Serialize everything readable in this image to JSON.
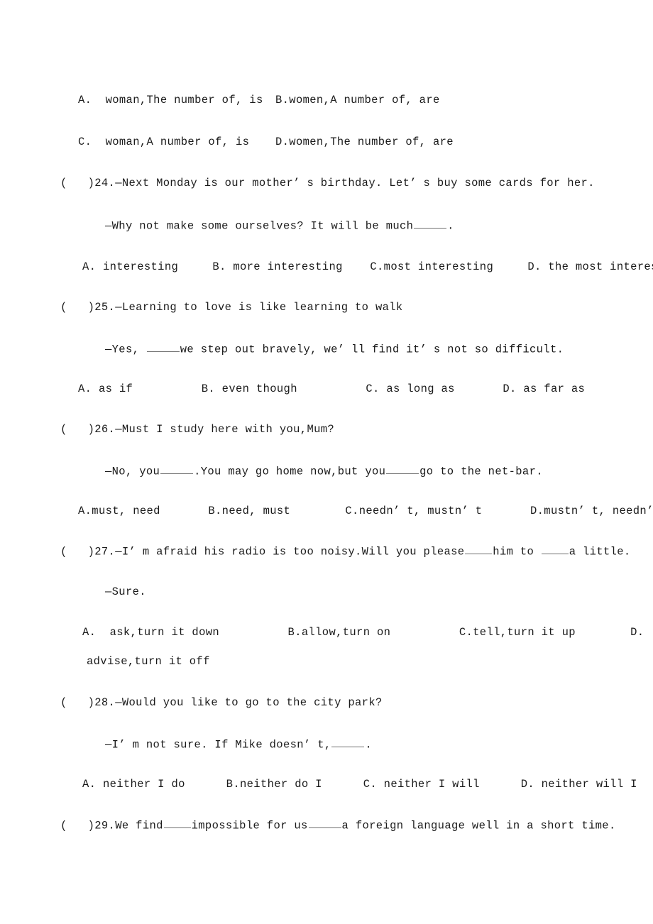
{
  "document": {
    "type": "exam-paper",
    "language": "en",
    "page_background": "#ffffff",
    "text_color": "#1a1a1a"
  },
  "content": {
    "prev_question_options": {
      "row1": {
        "left": "A.  woman,The number of, is",
        "right": "B.women,A number of, are"
      },
      "row2": {
        "left": "C.  woman,A number of, is",
        "right": "D.women,The number of, are"
      }
    },
    "questions": [
      {
        "marker": "(   )24.",
        "stem": "—Next Monday is our mother’ s birthday. Let’ s buy some cards for her.",
        "reply_before_blank": "—Why not make some ourselves? It will be much",
        "reply_after_blank": ".",
        "options_line": "A. interesting     B. more interesting    C.most interesting     D. the most interesting",
        "options": [
          "A. interesting",
          "B. more interesting",
          "C.most interesting",
          "D. the most interesting"
        ]
      },
      {
        "marker": "(   )25.",
        "stem": "—Learning to love is like learning to walk",
        "reply_before_blank": "—Yes, ",
        "reply_after_blank": "we step out bravely, we’ ll find it’ s not so difficult.",
        "options_line": "A. as if          B. even though          C. as long as       D. as far as",
        "options": [
          "A. as if",
          "B. even though",
          "C. as long as",
          "D. as far as"
        ]
      },
      {
        "marker": "(   )26.",
        "stem": "—Must I study here with you,Mum?",
        "reply_part1": "—No, you",
        "reply_part2": ".You may go home now,but you",
        "reply_part3": "go to the net-bar.",
        "options_line": "A.must, need       B.need, must        C.needn’ t, mustn’ t       D.mustn’ t, needn’ t",
        "options": [
          "A.must, need",
          "B.need, must",
          "C.needn’ t, mustn’ t",
          "D.mustn’ t, needn’ t"
        ]
      },
      {
        "marker": "(   )27.",
        "stem_part1": "—I’ m afraid his radio is too noisy.Will you please",
        "stem_part2": "him to ",
        "stem_part3": "a little.",
        "reply": "—Sure.",
        "options_line_1": "A.  ask,turn it down          B.allow,turn on          C.tell,turn it up        D.",
        "options_line_2": "advise,turn it off",
        "options": [
          "A.  ask,turn it down",
          "B.allow,turn on",
          "C.tell,turn it up",
          "D. advise,turn it off"
        ]
      },
      {
        "marker": "(   )28.",
        "stem": "—Would you like to go to the city park?",
        "reply_before_blank": "—I’ m not sure. If Mike doesn’ t,",
        "reply_after_blank": ".",
        "options_line": "A. neither I do      B.neither do I      C. neither I will      D. neither will I",
        "options": [
          "A. neither I do",
          "B.neither do I",
          "C. neither I will",
          "D. neither will I"
        ]
      },
      {
        "marker": "(   )29.",
        "stem_part1": "We find",
        "stem_part2": "impossible for us",
        "stem_part3": "a foreign language well in a short time."
      }
    ]
  }
}
